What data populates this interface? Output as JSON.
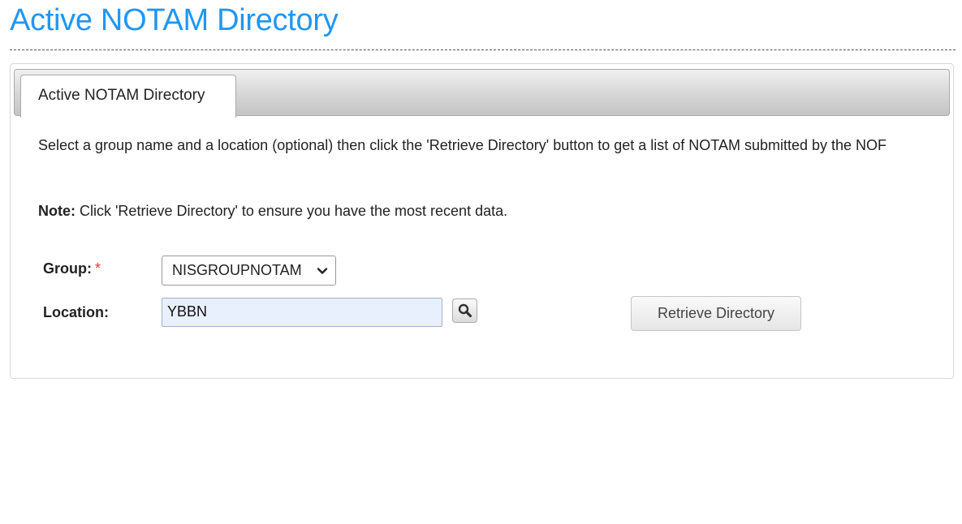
{
  "page": {
    "title": "Active NOTAM Directory"
  },
  "tabs": [
    {
      "label": "Active NOTAM Directory",
      "selected": true
    }
  ],
  "content": {
    "description": "Select a group name and a location (optional) then click the 'Retrieve Directory' button to get a list of NOTAM submitted by the NOF",
    "note_label": "Note:",
    "note_text": " Click 'Retrieve Directory' to ensure you have the most recent data."
  },
  "form": {
    "group_label": "Group:",
    "required_marker": "*",
    "group_value": "NISGROUPNOTAM",
    "location_label": "Location:",
    "location_value": "YBBN",
    "search_icon": "magnifier-icon",
    "retrieve_label": "Retrieve Directory"
  },
  "colors": {
    "title": "#2196f3",
    "required": "#e53935",
    "input_bg": "#e8f0fe"
  }
}
